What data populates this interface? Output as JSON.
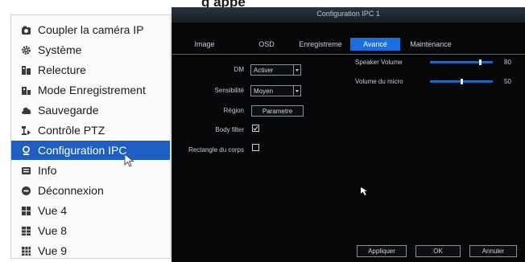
{
  "caption": "g appe",
  "menu": {
    "items": [
      {
        "label": "Coupler la caméra IP",
        "icon": "camera-icon"
      },
      {
        "label": "Système",
        "icon": "gear-icon"
      },
      {
        "label": "Relecture",
        "icon": "playback-icon"
      },
      {
        "label": "Mode Enregistrement",
        "icon": "record-mode-icon"
      },
      {
        "label": "Sauvegarde",
        "icon": "backup-icon"
      },
      {
        "label": "Contrôle PTZ",
        "icon": "ptz-icon"
      },
      {
        "label": "Configuration IPC",
        "icon": "ipc-config-icon"
      },
      {
        "label": "Info",
        "icon": "info-icon"
      },
      {
        "label": "Déconnexion",
        "icon": "logout-icon"
      },
      {
        "label": "Vue 4",
        "icon": "grid-view-icon"
      },
      {
        "label": "Vue 8",
        "icon": "grid-view-icon"
      },
      {
        "label": "Vue 9",
        "icon": "grid-view-icon"
      }
    ],
    "active_index": 6
  },
  "window": {
    "title": "Configuration IPC 1",
    "tabs": [
      "Image",
      "OSD",
      "Enregistreme",
      "Avancé",
      "Maintenance"
    ],
    "active_tab": "Avancé",
    "form": {
      "dm_label": "DM",
      "dm_value": "Activer",
      "sens_label": "Sensibilité",
      "sens_value": "Moyen",
      "region_label": "Région",
      "region_button": "Parametre",
      "body_filter_label": "Body filter",
      "body_filter_checked": true,
      "rect_label": "Rectangle du corps",
      "rect_checked": false
    },
    "sliders": [
      {
        "label": "Speaker Volume",
        "value": 80
      },
      {
        "label": "Volume du micro",
        "value": 50
      }
    ],
    "buttons": {
      "apply": "Appliquer",
      "ok": "OK",
      "cancel": "Annuler"
    }
  },
  "colors": {
    "menu_highlight": "#1f5fc1",
    "tab_active": "#1a6fe0",
    "window_bg": "#060709"
  }
}
